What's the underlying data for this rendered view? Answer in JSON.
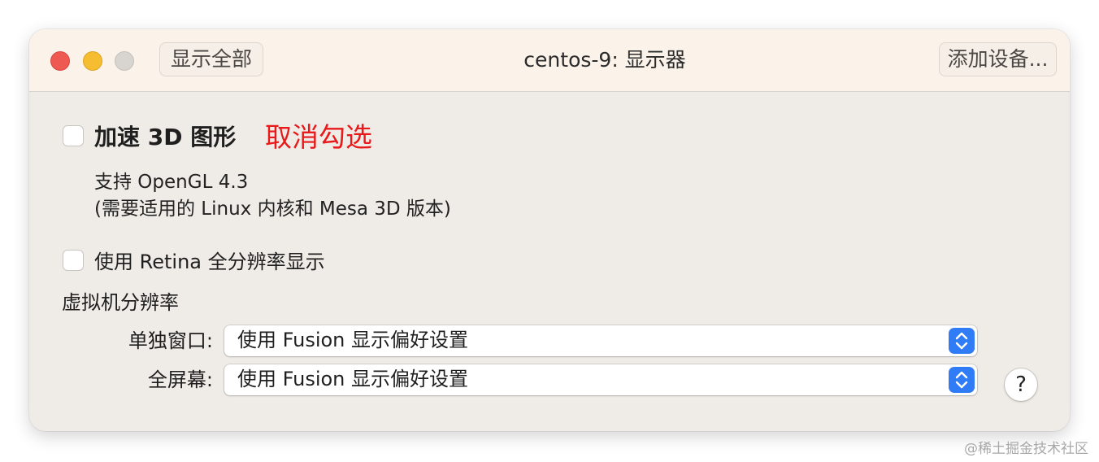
{
  "window": {
    "title": "centos-9: 显示器",
    "toolbar": {
      "show_all_label": "显示全部",
      "add_device_label": "添加设备..."
    }
  },
  "display": {
    "accelerate_3d": {
      "label": "加速 3D 图形",
      "checked": false,
      "annotation": "取消勾选",
      "annotation_color": "#e8191a",
      "description_line1": "支持 OpenGL 4.3",
      "description_line2": "(需要适用的 Linux 内核和 Mesa 3D 版本)"
    },
    "retina": {
      "label": "使用 Retina 全分辨率显示",
      "checked": false
    },
    "resolution": {
      "section_title": "虚拟机分辨率",
      "single_window": {
        "label": "单独窗口:",
        "value": "使用 Fusion 显示偏好设置"
      },
      "full_screen": {
        "label": "全屏幕:",
        "value": "使用 Fusion 显示偏好设置"
      }
    },
    "help_label": "?"
  },
  "watermark": "@稀土掘金技术社区",
  "colors": {
    "accent": "#2f7cf6",
    "close": "#ee5a52",
    "minimize": "#f5bd2f",
    "zoom_disabled": "#d8d4cf",
    "titlebar": "#fbf3ea",
    "window_body": "#efece7"
  },
  "icons": {
    "stepper": "chevron-up-down-icon",
    "help": "question-mark-icon"
  }
}
